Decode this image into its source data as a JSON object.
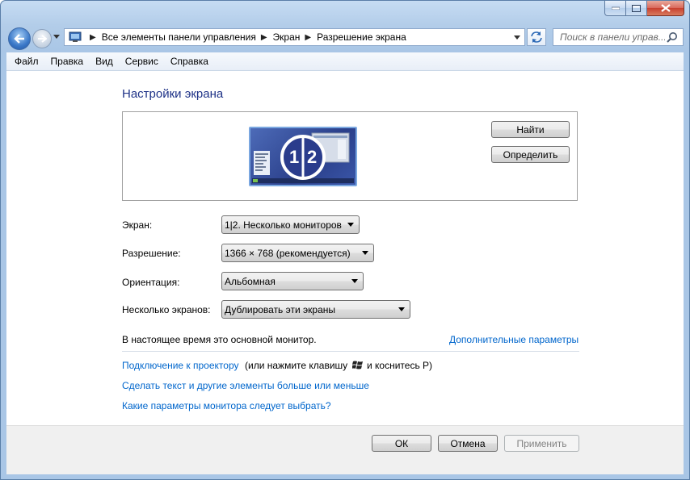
{
  "window": {
    "colors": {
      "frame": "#b3cde9",
      "title_blue": "#1e3287",
      "link": "#0066cc",
      "close": "#c8402e"
    }
  },
  "nav": {
    "back_icon": "back-arrow-icon",
    "forward_icon": "forward-arrow-icon",
    "address": {
      "crumbs": [
        "Все элементы панели управления",
        "Экран",
        "Разрешение экрана"
      ]
    },
    "search": {
      "placeholder": "Поиск в панели управ..."
    }
  },
  "menu": {
    "items": [
      "Файл",
      "Правка",
      "Вид",
      "Сервис",
      "Справка"
    ]
  },
  "main": {
    "title": "Настройки экрана",
    "monitor_label": "1|2",
    "monitor_num1": "1",
    "monitor_num2": "2",
    "find_button": "Найти",
    "identify_button": "Определить",
    "fields": {
      "screen": {
        "label": "Экран:",
        "value": "1|2. Несколько мониторов"
      },
      "resolution": {
        "label": "Разрешение:",
        "value": "1366 × 768 (рекомендуется)"
      },
      "orientation": {
        "label": "Ориентация:",
        "value": "Альбомная"
      },
      "multiple": {
        "label": "Несколько экранов:",
        "value": "Дублировать эти экраны"
      }
    },
    "primary_text": "В настоящее время это основной монитор.",
    "advanced_link": "Дополнительные параметры",
    "projector_link": "Подключение к проектору",
    "projector_text_a": "(или нажмите клавишу",
    "projector_text_b": "и коснитесь P)",
    "text_size_link": "Сделать текст и другие элементы больше или меньше",
    "which_monitor_link": "Какие параметры монитора следует выбрать?"
  },
  "footer": {
    "ok": "ОК",
    "cancel": "Отмена",
    "apply": "Применить"
  }
}
